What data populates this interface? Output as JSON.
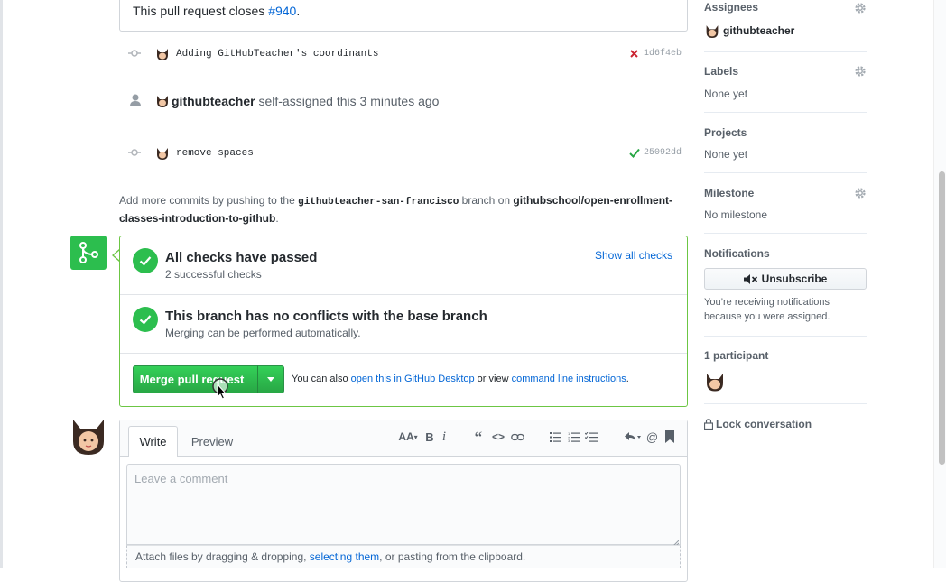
{
  "description": {
    "text_before": "This pull request closes ",
    "issue_link": "#940",
    "text_after": "."
  },
  "timeline": {
    "commit1": {
      "message": "Adding GitHubTeacher's coordinants",
      "sha": "1d6f4eb",
      "status_icon": "x-icon",
      "status_color": "#cb2431"
    },
    "event": {
      "actor": "githubteacher",
      "action": "self-assigned this 3 minutes ago"
    },
    "commit2": {
      "message": "remove spaces",
      "sha": "25092dd",
      "status_icon": "check-icon",
      "status_color": "#28a745"
    },
    "push_hint": {
      "prefix": "Add more commits by pushing to the ",
      "branch": "githubteacher-san-francisco",
      "middle": " branch on ",
      "repo": "githubschool/open-enrollment-classes-introduction-to-github",
      "suffix": "."
    }
  },
  "merge_box": {
    "checks_title": "All checks have passed",
    "checks_sub": "2 successful checks",
    "show_all_checks": "Show all checks",
    "conflicts_title": "This branch has no conflicts with the base branch",
    "conflicts_sub": "Merging can be performed automatically.",
    "merge_button": "Merge pull request",
    "also_prefix": "You can also ",
    "desktop_link": "open this in GitHub Desktop",
    "also_middle": " or view ",
    "cli_link": "command line instructions",
    "also_suffix": ".",
    "accent_color": "#2cbe4e"
  },
  "composer": {
    "tab_write": "Write",
    "tab_preview": "Preview",
    "toolbar": {
      "header": "AA",
      "bold": "B",
      "italic": "i",
      "quote": "“",
      "code": "<>",
      "mention": "@"
    },
    "placeholder": "Leave a comment",
    "attach_prefix": "Attach files by dragging & dropping, ",
    "attach_link": "selecting them",
    "attach_suffix": ", or pasting from the clipboard."
  },
  "sidebar": {
    "assignees_heading": "Assignees",
    "assignee_name": "githubteacher",
    "labels_heading": "Labels",
    "labels_value": "None yet",
    "projects_heading": "Projects",
    "projects_value": "None yet",
    "milestone_heading": "Milestone",
    "milestone_value": "No milestone",
    "notifications_heading": "Notifications",
    "unsubscribe_label": "Unsubscribe",
    "notifications_reason": "You’re receiving notifications because you were assigned.",
    "participants_heading": "1 participant",
    "lock_label": "Lock conversation"
  }
}
